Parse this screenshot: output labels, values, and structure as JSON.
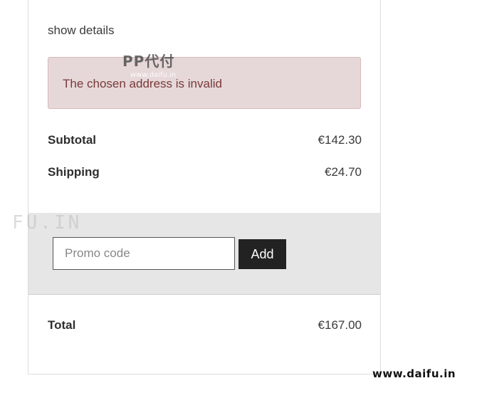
{
  "summary": {
    "show_details": "show details",
    "alert_message": "The chosen address is invalid",
    "subtotal_label": "Subtotal",
    "subtotal_value": "€142.30",
    "shipping_label": "Shipping",
    "shipping_value": "€24.70",
    "total_label": "Total",
    "total_value": "€167.00"
  },
  "promo": {
    "placeholder": "Promo code",
    "value": "",
    "add_label": "Add"
  },
  "watermarks": {
    "left": "FU.IN",
    "center": "PP代付",
    "center_small": "www.daifu.in",
    "bottom": "www.daifu.in"
  },
  "colors": {
    "alert_background": "#e6d8d8",
    "alert_text": "#7a3939",
    "promo_band": "#e6e6e6",
    "button_background": "#222222"
  }
}
